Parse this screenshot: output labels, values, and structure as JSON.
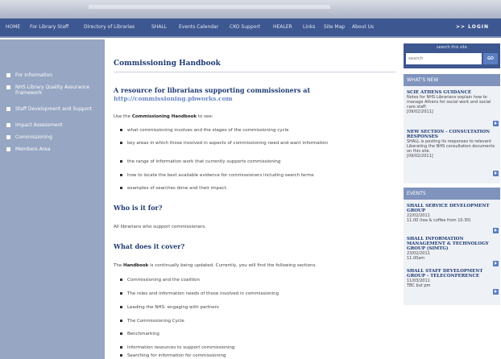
{
  "nav": {
    "items": [
      "HOME",
      "For Library Staff",
      "Directory of Libraries",
      "SHALL",
      "Events Calendar",
      "CKO Support",
      "HEALER",
      "Links",
      "Site Map",
      "About Us"
    ],
    "login": ">> LOGIN"
  },
  "sidebar": {
    "items": [
      "For Information",
      "NHS Library Quality Assurance Framework",
      "Staff Development and Support",
      "Impact Assessment",
      "Commissioning",
      "Members Area"
    ]
  },
  "main": {
    "title": "Commissioning Handbook",
    "heading": "A resource for librarians supporting commissioners at",
    "url": "http://commissioning.pbworks.com",
    "intro_pre": "Use the",
    "intro_bold": "Commissioning Handbook",
    "intro_post": "to see:",
    "see_items": [
      "what commissioning involves and the stages of the commissioning cycle",
      "key areas in which those involved in aspects of commissioning need and want information",
      "the range of information work that currently supports commissioning",
      "how to locate the best available evidence for commissioners including search terms",
      "examples of searches done and their impact."
    ],
    "who_heading": "Who is it for?",
    "who_text": "All librarians who support commissioners.",
    "what_heading": "What does it cover?",
    "cover_pre": "The",
    "cover_bold": "Handbook",
    "cover_post": "is continually being updated. Currently, you will find the following sections.",
    "cover_items": [
      "Commissioning and the coalition",
      "The roles and information needs of those involved in commissioning",
      "Leading the NHS: engaging with partners",
      "The Commissioning Cycle",
      "Benchmarking",
      "Information resources to support commissioning",
      "Searching for information for commissioning"
    ]
  },
  "search": {
    "label": "search this site",
    "placeholder": "search",
    "go": "GO"
  },
  "whats_new": {
    "heading": "WHAT'S NEW",
    "items": [
      {
        "title": "SCIE ATHENS GUIDANCE",
        "text": "Notes for NHS Librarians explain how to manage Athens for social work and social care staff.",
        "date": "[09/02/2011]"
      },
      {
        "title": "NEW SECTION - CONSULTATION RESPONSES",
        "text": "SHALL is posting its responses to relevant Liberating the NHS consultation documents on this site.",
        "date": "[09/02/2011]"
      }
    ]
  },
  "events": {
    "heading": "EVENTS",
    "items": [
      {
        "title": "SHALL SERVICE DEVELOPMENT GROUP",
        "date": "22/02/2011",
        "time": "11.00 (tea & coffee from 10.30)"
      },
      {
        "title": "SHALL INFORMATION MANAGEMENT & TECHNOLOGY GROUP (SIMTG)",
        "date": "23/02/2011",
        "time": "11.00am"
      },
      {
        "title": "SHALL STAFF DEVELOPMENT GROUP - TELECONFERENCE",
        "date": "11/03/2011",
        "time": "TBC but pm"
      }
    ]
  }
}
